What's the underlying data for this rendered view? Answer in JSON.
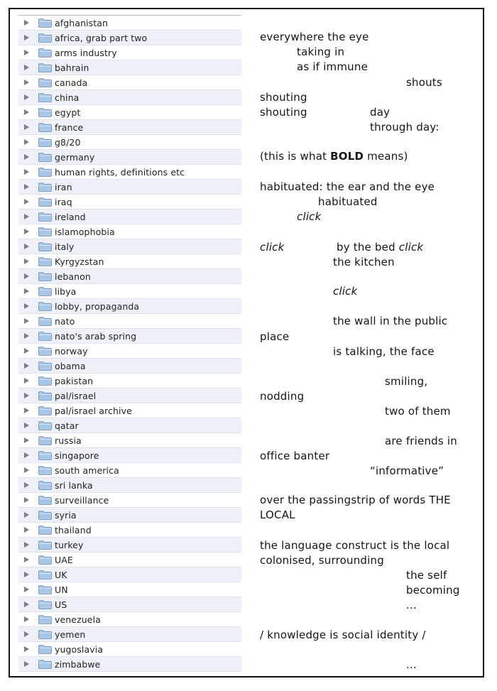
{
  "folders": [
    "afghanistan",
    "africa, grab part two",
    "arms industry",
    "bahrain",
    "canada",
    "china",
    "egypt",
    "france",
    "g8/20",
    "germany",
    "human rights,  definitions etc",
    "iran",
    "iraq",
    "ireland",
    "islamophobia",
    "italy",
    "Kyrgyzstan",
    "lebanon",
    "libya",
    "lobby, propaganda",
    "nato",
    "nato's arab spring",
    "norway",
    "obama",
    "pakistan",
    "pal/israel",
    "pal/israel archive",
    "qatar",
    "russia",
    "singapore",
    "south america",
    "sri lanka",
    "surveillance",
    "syria",
    "thailand",
    "turkey",
    "UAE",
    "UK",
    "UN",
    "US",
    "venezuela",
    "yemen",
    "yugoslavia",
    "zimbabwe"
  ],
  "icons": {
    "row_arrow": "disclosure-triangle-icon",
    "row_folder": "folder-icon"
  },
  "colors": {
    "row_alt": "#eef1f8",
    "folder_blue": "#a9c6e6",
    "arrow": "#7a7f88",
    "border": "#111111"
  },
  "poem": {
    "l01": "everywhere the eye",
    "l02": "taking in",
    "l03": "as if immune",
    "l04": "shouts",
    "l05": "shouting",
    "l06a": "shouting",
    "l06b": "day",
    "l07": "through day:",
    "l08a": "(this is what ",
    "l08b": "BOLD",
    "l08c": " means)",
    "l09": "habituated: the ear and the eye",
    "l10": "habituated",
    "l11": "click",
    "l12a": "click",
    "l12b": "by the bed ",
    "l12c": "click",
    "l13": "the kitchen",
    "l14": "click",
    "l15": "the wall in the public",
    "l16": "place",
    "l17": "is talking, the face",
    "l18": "smiling,",
    "l19": "nodding",
    "l20": "two of them",
    "l21": "are friends in",
    "l22": "office banter",
    "l23": "“informative”",
    "l24": "over the passingstrip of words   THE",
    "l25": "LOCAL",
    "l26": "the language construct is the local",
    "l27": "colonised, surrounding",
    "l28": "the self",
    "l29": "becoming",
    "l30": "...",
    "l31": "/ knowledge is  social identity   /",
    "l32": "..."
  }
}
